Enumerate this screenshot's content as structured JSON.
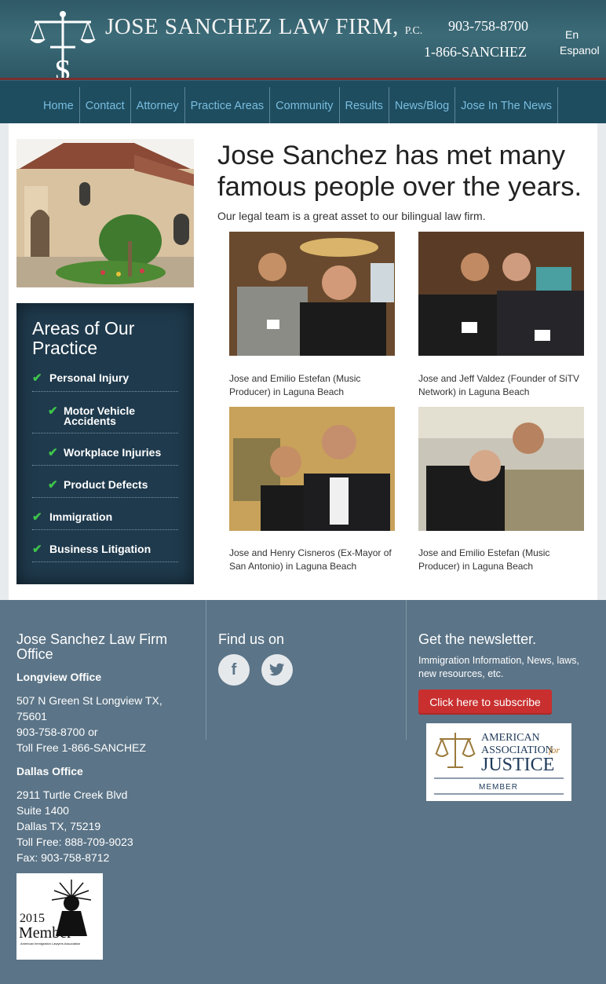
{
  "header": {
    "firm_name": "JOSE SANCHEZ LAW FIRM,",
    "firm_suffix": "P.C.",
    "phone_local": "903-758-8700",
    "phone_tollfree": "1-866-SANCHEZ",
    "lang_en": "En",
    "lang_es": "Espanol",
    "logo_letter": "S"
  },
  "nav": {
    "items": [
      "Home",
      "Contact",
      "Attorney",
      "Practice Areas",
      "Community",
      "Results",
      "News/Blog",
      "Jose In The News"
    ]
  },
  "sidebar": {
    "practice_title": "Areas of Our Practice",
    "practice_items": [
      {
        "label": "Personal Injury",
        "sub": false
      },
      {
        "label": "Motor Vehicle Accidents",
        "sub": true
      },
      {
        "label": "Workplace Injuries",
        "sub": true
      },
      {
        "label": "Product Defects",
        "sub": true
      },
      {
        "label": "Immigration",
        "sub": false
      },
      {
        "label": "Business Litigation",
        "sub": false
      }
    ]
  },
  "main": {
    "headline": "Jose Sanchez has met many famous people over the years.",
    "subline": "Our legal team is a great asset to our bilingual law firm.",
    "photos": [
      {
        "caption": "Jose and Emilio Estefan (Music Producer) in Laguna Beach"
      },
      {
        "caption": "Jose and Jeff Valdez (Founder of SiTV Network) in Laguna Beach"
      },
      {
        "caption": "Jose and Henry Cisneros (Ex-Mayor of San Antonio) in Laguna Beach"
      },
      {
        "caption": "Jose and Emilio Estefan (Music Producer) in Laguna Beach"
      }
    ]
  },
  "footer": {
    "office_title": "Jose Sanchez Law Firm Office",
    "longview_heading": "Longview Office",
    "longview_lines": [
      "507 N Green St Longview TX,",
      "75601",
      "903-758-8700 or",
      "Toll Free 1-866-SANCHEZ"
    ],
    "dallas_heading": "Dallas Office",
    "dallas_lines": [
      "2911 Turtle Creek Blvd",
      "Suite 1400",
      "Dallas TX, 75219",
      "Toll Free: 888-709-9023",
      "Fax: 903-758-8712"
    ],
    "find_us": "Find us on",
    "facebook_glyph": "f",
    "twitter_glyph": "t",
    "newsletter_title": "Get the newsletter.",
    "newsletter_desc": "Immigration Information, News, laws, new resources, etc.",
    "subscribe_label": "Click here to subscribe",
    "aaj_line1": "AMERICAN",
    "aaj_line2": "ASSOCIATION",
    "aaj_line2b": "for",
    "aaj_line3": "JUSTICE",
    "aaj_line4": "MEMBER",
    "aila_year": "2015",
    "aila_member": "Member",
    "aila_org": "American Immigration Lawyers Association"
  },
  "colors": {
    "header_teal": "#3c6b78",
    "nav_bg": "#1e4d5f",
    "nav_link": "#79bde0",
    "practice_bg": "#1f3a4d",
    "check_green": "#3ec64a",
    "footer_bg": "#5b7487",
    "subscribe_red": "#c92f2f"
  }
}
